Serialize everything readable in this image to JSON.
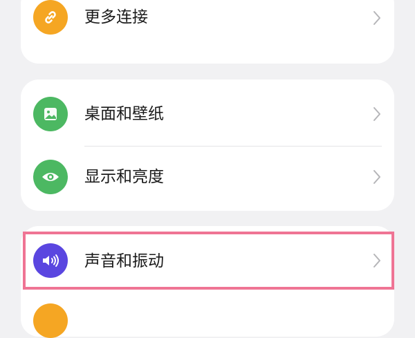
{
  "settings": {
    "group1": {
      "more_connections": {
        "label": "更多连接",
        "icon": "link-icon",
        "icon_color": "#f5a623"
      }
    },
    "group2": {
      "wallpaper": {
        "label": "桌面和壁纸",
        "icon": "image-icon",
        "icon_color": "#4cb862"
      },
      "display": {
        "label": "显示和亮度",
        "icon": "eye-icon",
        "icon_color": "#4cb862"
      }
    },
    "group3": {
      "sound": {
        "label": "声音和振动",
        "icon": "speaker-icon",
        "icon_color": "#5a46e0"
      },
      "next_item": {
        "icon_color": "#f5a623"
      }
    }
  },
  "highlight": {
    "color": "#ef7494",
    "target": "sound"
  }
}
